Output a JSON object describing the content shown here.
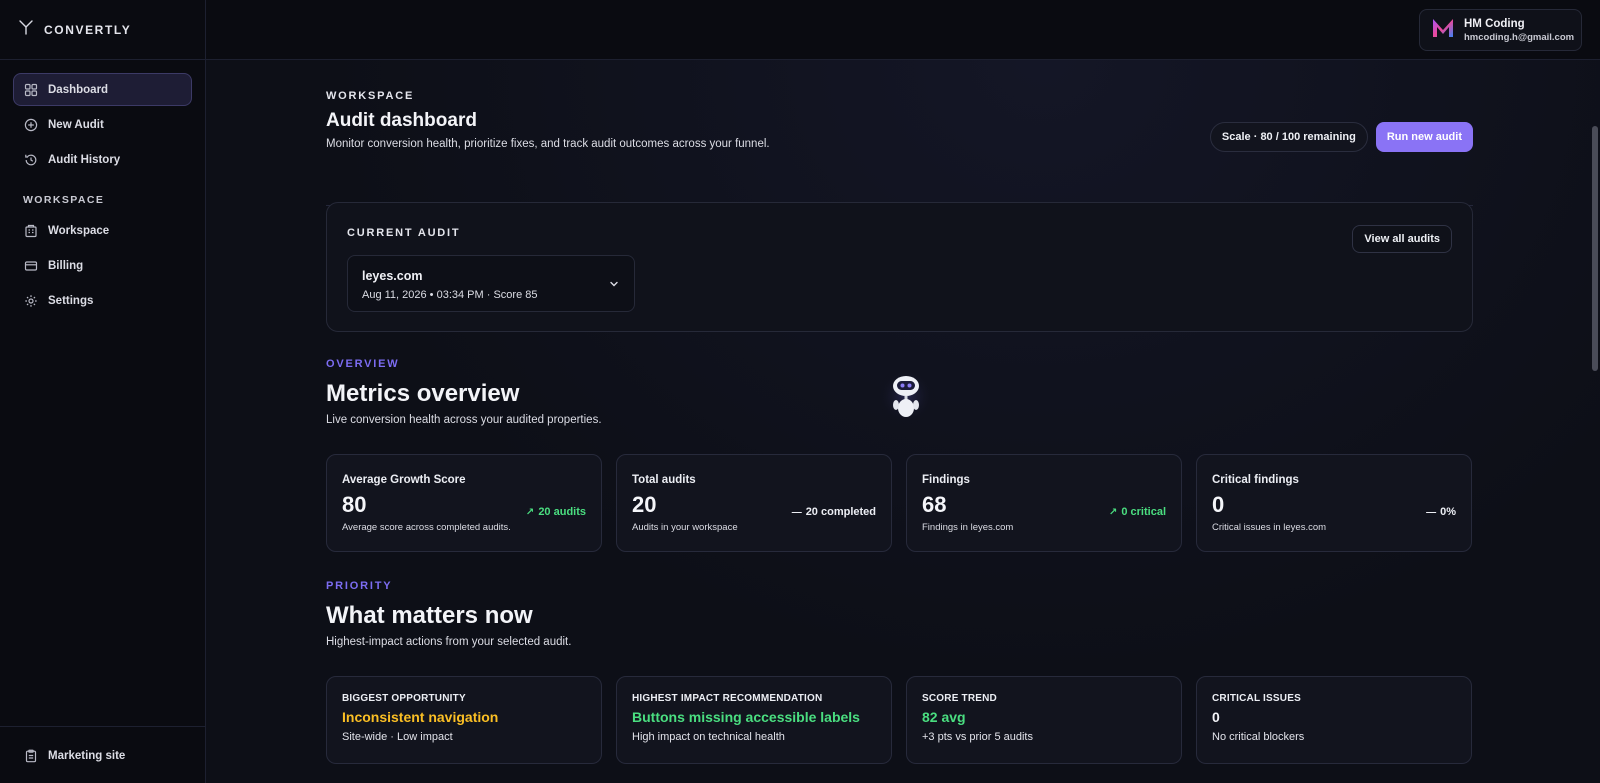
{
  "brand": {
    "name": "CONVERTLY"
  },
  "sidebar": {
    "items": [
      {
        "label": "Dashboard"
      },
      {
        "label": "New Audit"
      },
      {
        "label": "Audit History"
      }
    ],
    "section_title": "WORKSPACE",
    "workspace_items": [
      {
        "label": "Workspace"
      },
      {
        "label": "Billing"
      },
      {
        "label": "Settings"
      }
    ],
    "footer": {
      "label": "Marketing site"
    }
  },
  "user": {
    "name": "HM Coding",
    "email": "hmcoding.h@gmail.com"
  },
  "header": {
    "eyebrow": "WORKSPACE",
    "title": "Audit dashboard",
    "subtitle": "Monitor conversion health, prioritize fixes, and track audit outcomes across your funnel.",
    "plan": "Scale · 80 / 100 remaining",
    "primary_button": "Run new audit"
  },
  "current_audit": {
    "eyebrow": "CURRENT AUDIT",
    "view_all": "View all audits",
    "domain": "leyes.com",
    "meta": "Aug 11, 2026 • 03:34 PM  ·  Score 85"
  },
  "overview": {
    "eyebrow": "OVERVIEW",
    "title": "Metrics overview",
    "subtitle": "Live conversion health across your audited properties."
  },
  "metrics": [
    {
      "label": "Average Growth Score",
      "value": "80",
      "note": "Average score across completed audits.",
      "delta": "20 audits",
      "delta_icon": "↗",
      "trend": "up"
    },
    {
      "label": "Total audits",
      "value": "20",
      "note": "Audits in your workspace",
      "delta": "20 completed",
      "delta_icon": "—",
      "trend": "flat"
    },
    {
      "label": "Findings",
      "value": "68",
      "note": "Findings in leyes.com",
      "delta": "0 critical",
      "delta_icon": "↗",
      "trend": "up"
    },
    {
      "label": "Critical findings",
      "value": "0",
      "note": "Critical issues in leyes.com",
      "delta": "0%",
      "delta_icon": "—",
      "trend": "flat"
    }
  ],
  "priority": {
    "eyebrow": "PRIORITY",
    "title": "What matters now",
    "subtitle": "Highest-impact actions from your selected audit."
  },
  "priority_cards": [
    {
      "label": "BIGGEST OPPORTUNITY",
      "title": "Inconsistent navigation",
      "sub": "Site-wide · Low impact",
      "color": "#fbbf24"
    },
    {
      "label": "HIGHEST IMPACT RECOMMENDATION",
      "title": "Buttons missing accessible labels",
      "sub": "High impact on technical health",
      "color": "#4ade80"
    },
    {
      "label": "SCORE TREND",
      "title": "82 avg",
      "sub": "+3 pts vs prior 5 audits",
      "color": "#4ade80"
    },
    {
      "label": "CRITICAL ISSUES",
      "title": "0",
      "sub": "No critical blockers",
      "color": "#f3f4f8"
    }
  ],
  "colors": {
    "accent": "#8a73f5",
    "positive": "#4ade80",
    "warning": "#fbbf24"
  }
}
